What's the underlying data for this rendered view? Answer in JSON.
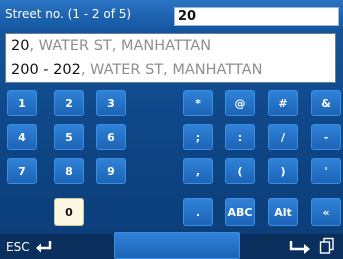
{
  "header": {
    "label": "Street no. (1 - 2 of 5)",
    "input_value": "20"
  },
  "results": [
    {
      "num": "20",
      "rest": ", WATER ST, MANHATTAN"
    },
    {
      "num": "200 - 202",
      "rest": ", WATER ST, MANHATTAN"
    }
  ],
  "keys": {
    "k1": "1",
    "k2": "2",
    "k3": "3",
    "k4": "4",
    "k5": "5",
    "k6": "6",
    "k7": "7",
    "k8": "8",
    "k9": "9",
    "k0": "0",
    "star": "*",
    "at": "@",
    "hash": "#",
    "amp": "&",
    "semicolon": ";",
    "colon": ":",
    "slash": "/",
    "dash": "-",
    "comma": ",",
    "lparen": "(",
    "rparen": ")",
    "apos": "'",
    "dot": ".",
    "abc": "ABC",
    "alt": "Alt",
    "back": "«"
  },
  "bottom": {
    "esc_label": "ESC"
  },
  "colors": {
    "key_blue": "#2f82d9",
    "background_blue": "#0e4585",
    "selected_key": "#fbf8e6"
  },
  "icons": {
    "esc": "return-arrow-icon",
    "ok": "right-turn-arrow-icon",
    "pages": "pages-icon"
  }
}
